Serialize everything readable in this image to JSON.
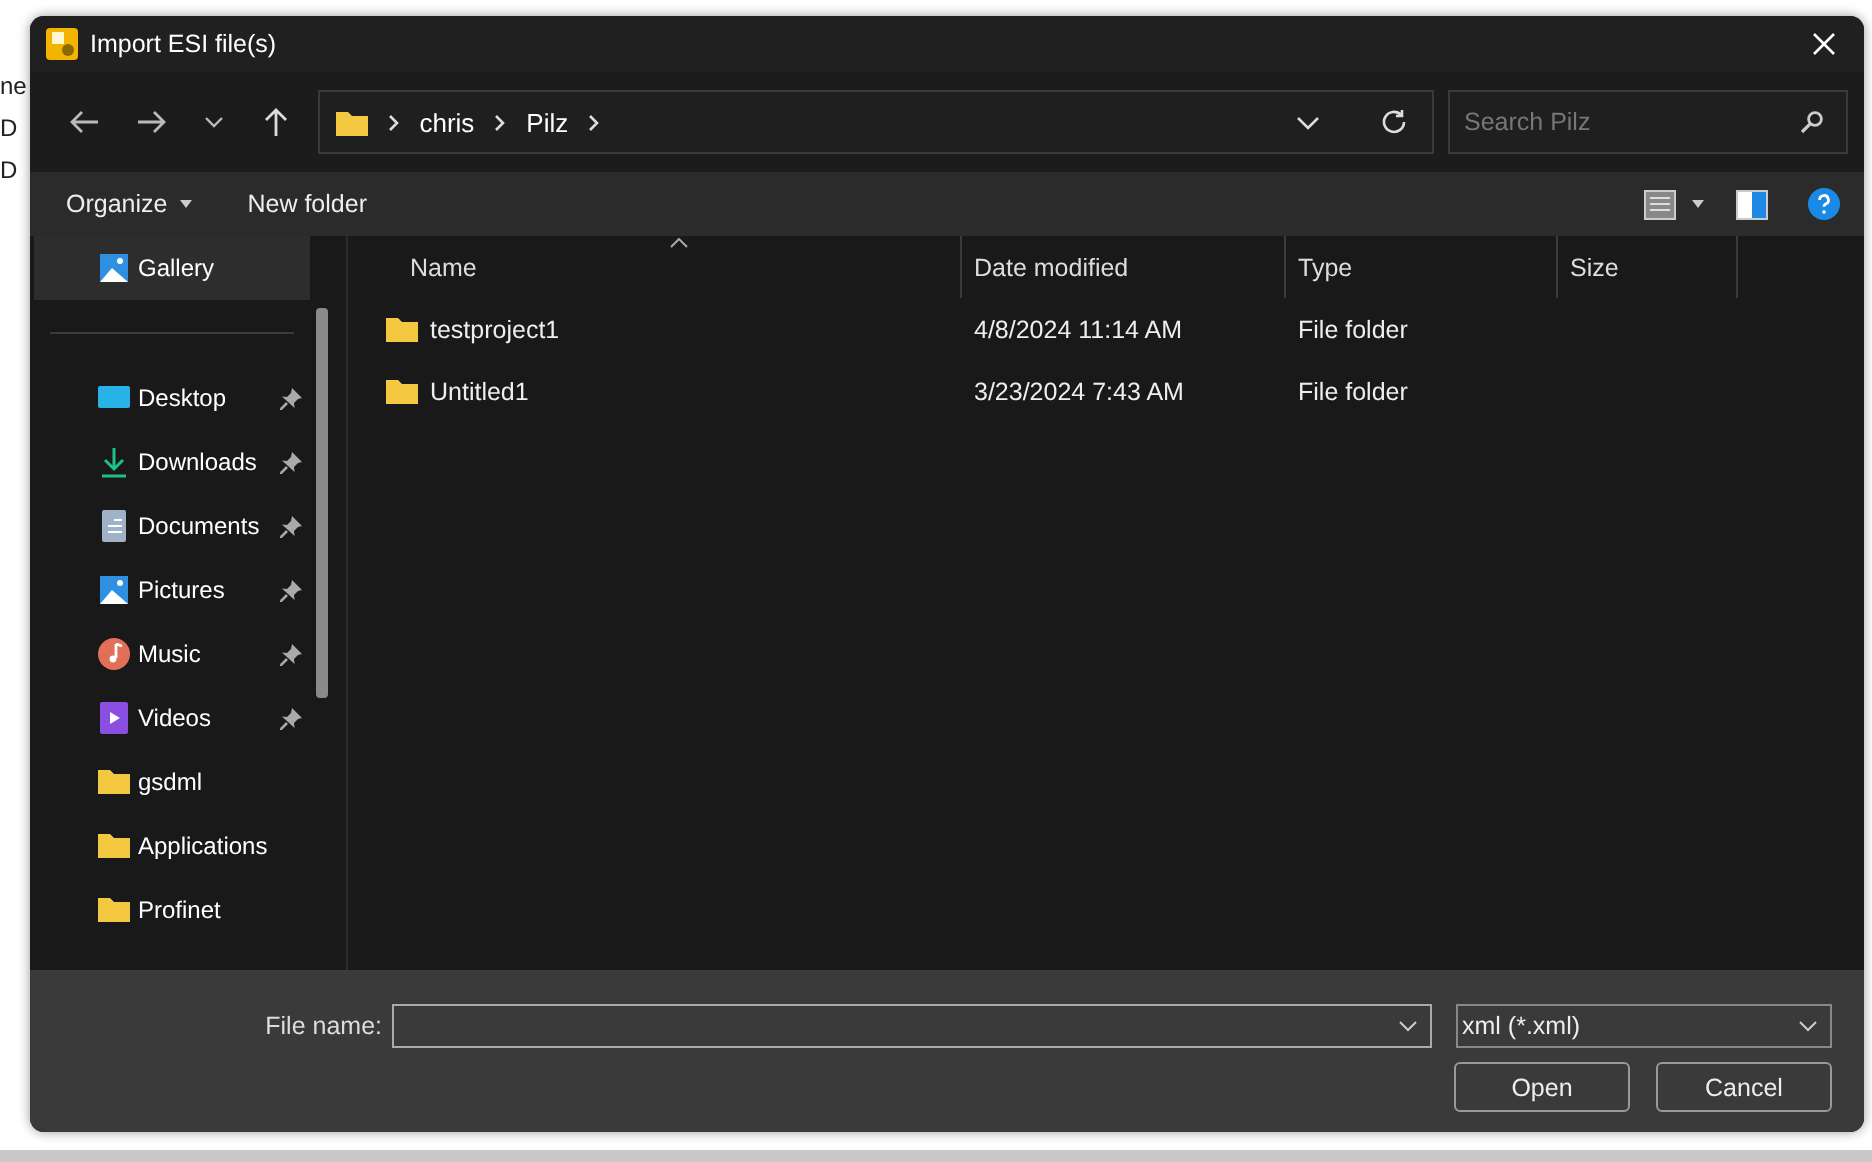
{
  "background": {
    "fragments": [
      "ne",
      "D",
      "D"
    ]
  },
  "window": {
    "title": "Import ESI file(s)"
  },
  "breadcrumb": [
    "chris",
    "Pilz"
  ],
  "search": {
    "placeholder": "Search Pilz"
  },
  "toolbar": {
    "organize": "Organize",
    "new_folder": "New folder"
  },
  "sidebar": {
    "items": [
      {
        "label": "Gallery",
        "kind": "gallery",
        "pinned": false,
        "selected": true
      },
      {
        "label": "Desktop",
        "kind": "desktop",
        "pinned": true,
        "selected": false
      },
      {
        "label": "Downloads",
        "kind": "downloads",
        "pinned": true,
        "selected": false
      },
      {
        "label": "Documents",
        "kind": "documents",
        "pinned": true,
        "selected": false
      },
      {
        "label": "Pictures",
        "kind": "pictures",
        "pinned": true,
        "selected": false
      },
      {
        "label": "Music",
        "kind": "music",
        "pinned": true,
        "selected": false
      },
      {
        "label": "Videos",
        "kind": "videos",
        "pinned": true,
        "selected": false
      },
      {
        "label": "gsdml",
        "kind": "folder",
        "pinned": false,
        "selected": false
      },
      {
        "label": "Applications",
        "kind": "folder",
        "pinned": false,
        "selected": false
      },
      {
        "label": "Profinet",
        "kind": "folder",
        "pinned": false,
        "selected": false
      }
    ]
  },
  "table": {
    "columns": [
      {
        "label": "Name",
        "sorted": true
      },
      {
        "label": "Date modified",
        "sorted": false
      },
      {
        "label": "Type",
        "sorted": false
      },
      {
        "label": "Size",
        "sorted": false
      }
    ],
    "rows": [
      {
        "name": "testproject1",
        "date": "4/8/2024 11:14 AM",
        "type": "File folder"
      },
      {
        "name": "Untitled1",
        "date": "3/23/2024 7:43 AM",
        "type": "File folder"
      }
    ]
  },
  "footer": {
    "file_name_label": "File name:",
    "filter": "xml (*.xml)",
    "buttons": [
      "Open",
      "Cancel"
    ]
  }
}
